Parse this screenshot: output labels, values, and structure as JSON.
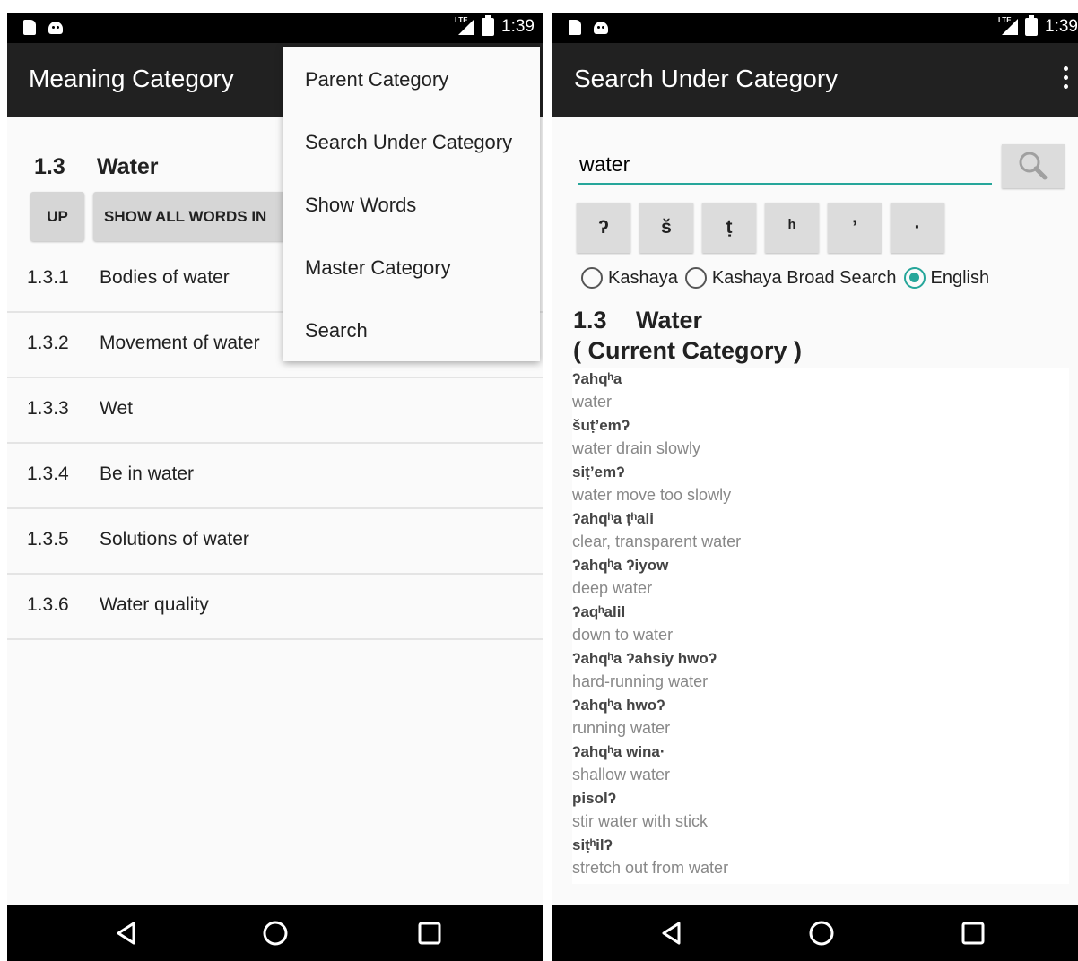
{
  "left": {
    "status": {
      "time": "1:39"
    },
    "appbar": {
      "title": "Meaning Category"
    },
    "category": {
      "num": "1.3",
      "name": "Water"
    },
    "buttons": {
      "up": "UP",
      "show_all": "SHOW ALL WORDS IN"
    },
    "list": [
      {
        "num": "1.3.1",
        "label": "Bodies of water"
      },
      {
        "num": "1.3.2",
        "label": "Movement of water"
      },
      {
        "num": "1.3.3",
        "label": "Wet"
      },
      {
        "num": "1.3.4",
        "label": "Be in water"
      },
      {
        "num": "1.3.5",
        "label": "Solutions of water"
      },
      {
        "num": "1.3.6",
        "label": "Water quality"
      }
    ],
    "menu": [
      "Parent Category",
      "Search Under Category",
      "Show Words",
      "Master Category",
      "Search"
    ]
  },
  "right": {
    "status": {
      "time": "1:39"
    },
    "appbar": {
      "title": "Search Under Category"
    },
    "search": {
      "value": "water"
    },
    "chars": [
      "ʔ",
      "š",
      "ṭ",
      "ʰ",
      "’",
      "·"
    ],
    "radios": [
      {
        "label": "Kashaya",
        "selected": false
      },
      {
        "label": "Kashaya Broad Search",
        "selected": false
      },
      {
        "label": "English",
        "selected": true
      }
    ],
    "category": {
      "num": "1.3",
      "name": "Water",
      "note": "( Current Category )"
    },
    "results": [
      {
        "kashaya": "ʔahqʰa",
        "english": "water"
      },
      {
        "kashaya": "šuṭ’emʔ",
        "english": "water drain slowly"
      },
      {
        "kashaya": "siṭ’emʔ",
        "english": "water move too slowly"
      },
      {
        "kashaya": "ʔahqʰa ṭʰali",
        "english": "clear, transparent water"
      },
      {
        "kashaya": "ʔahqʰa ʔiyow",
        "english": "deep water"
      },
      {
        "kashaya": "ʔaqʰalil",
        "english": "down to water"
      },
      {
        "kashaya": "ʔahqʰa ʔahsiy hwoʔ",
        "english": "hard-running water"
      },
      {
        "kashaya": "ʔahqʰa hwoʔ",
        "english": "running water"
      },
      {
        "kashaya": "ʔahqʰa wina·",
        "english": "shallow water"
      },
      {
        "kashaya": "pisolʔ",
        "english": "stir water with stick"
      },
      {
        "kashaya": "siṭʰilʔ",
        "english": "stretch out from water"
      }
    ]
  },
  "colors": {
    "accent": "#26a69a",
    "appbar": "#212121"
  }
}
